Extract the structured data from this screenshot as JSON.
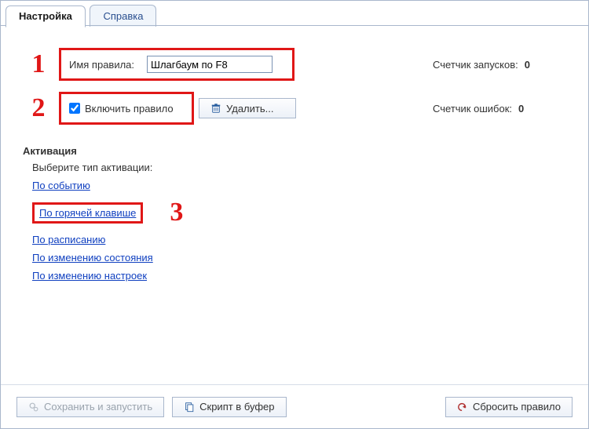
{
  "tabs": {
    "settings": "Настройка",
    "help": "Справка"
  },
  "rule_name": {
    "label": "Имя правила:",
    "value": "Шлагбаум по F8"
  },
  "enable_rule": {
    "label": "Включить правило",
    "checked": true
  },
  "delete_btn": "Удалить...",
  "counters": {
    "runs_label": "Счетчик запусков:",
    "runs_value": "0",
    "errors_label": "Счетчик ошибок:",
    "errors_value": "0"
  },
  "activation": {
    "title": "Активация",
    "subtitle": "Выберите тип активации:",
    "links": {
      "by_event": "По событию",
      "by_hotkey": "По горячей клавише",
      "by_schedule": "По расписанию",
      "by_state_change": "По изменению состояния",
      "by_settings_change": "По изменению настроек"
    }
  },
  "footer": {
    "save_run": "Сохранить и запустить",
    "script_to_buffer": "Скрипт в буфер",
    "reset_rule": "Сбросить правило"
  },
  "annotations": {
    "one": "1",
    "two": "2",
    "three": "3"
  }
}
